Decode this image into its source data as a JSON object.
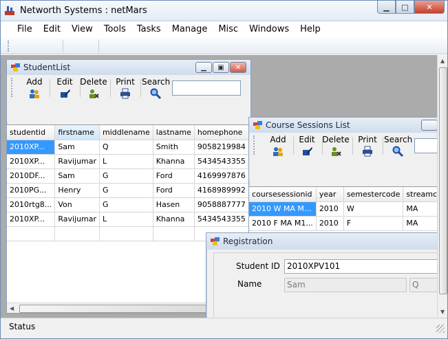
{
  "window": {
    "title": "Networth Systems : netMars"
  },
  "menu": [
    "File",
    "Edit",
    "View",
    "Tools",
    "Tasks",
    "Manage",
    "Misc",
    "Windows",
    "Help"
  ],
  "student_list": {
    "title": "StudentList",
    "toolbar": {
      "add": "Add",
      "edit": "Edit",
      "delete": "Delete",
      "print": "Print",
      "search": "Search",
      "search_value": ""
    },
    "columns": [
      "studentid",
      "firstname",
      "middlename",
      "lastname",
      "homephone"
    ],
    "rows": [
      [
        "2010XP...",
        "Sam",
        "Q",
        "Smith",
        "9058219984"
      ],
      [
        "2010XP...",
        "Ravijumar",
        "L",
        "Khanna",
        "5434543355"
      ],
      [
        "2010DF...",
        "Sam",
        "G",
        "Ford",
        "4169997876"
      ],
      [
        "2010PG...",
        "Henry",
        "G",
        "Ford",
        "4168989992"
      ],
      [
        "2010rtg8...",
        "Von",
        "G",
        "Hasen",
        "9058887777"
      ],
      [
        "2010XP...",
        "Ravijumar",
        "L",
        "Khanna",
        "5434543355"
      ]
    ]
  },
  "course_sessions": {
    "title": "Course Sessions List",
    "toolbar": {
      "add": "Add",
      "edit": "Edit",
      "delete": "Delete",
      "print": "Print",
      "search": "Search"
    },
    "columns": [
      "coursesessionid",
      "year",
      "semestercode",
      "streamc"
    ],
    "rows": [
      [
        "2010 W MA M...",
        "2010",
        "W",
        "MA"
      ],
      [
        "2010 F MA M1...",
        "2010",
        "F",
        "MA"
      ]
    ]
  },
  "registration": {
    "title": "Registration",
    "student_id_label": "Student ID",
    "student_id_value": "2010XPV101",
    "name_label": "Name",
    "first_name_value": "Sam",
    "middle_value": "Q"
  },
  "status": {
    "text": "Status"
  },
  "colors": {
    "selection": "#3399ff",
    "mdi_background": "#ababab"
  }
}
